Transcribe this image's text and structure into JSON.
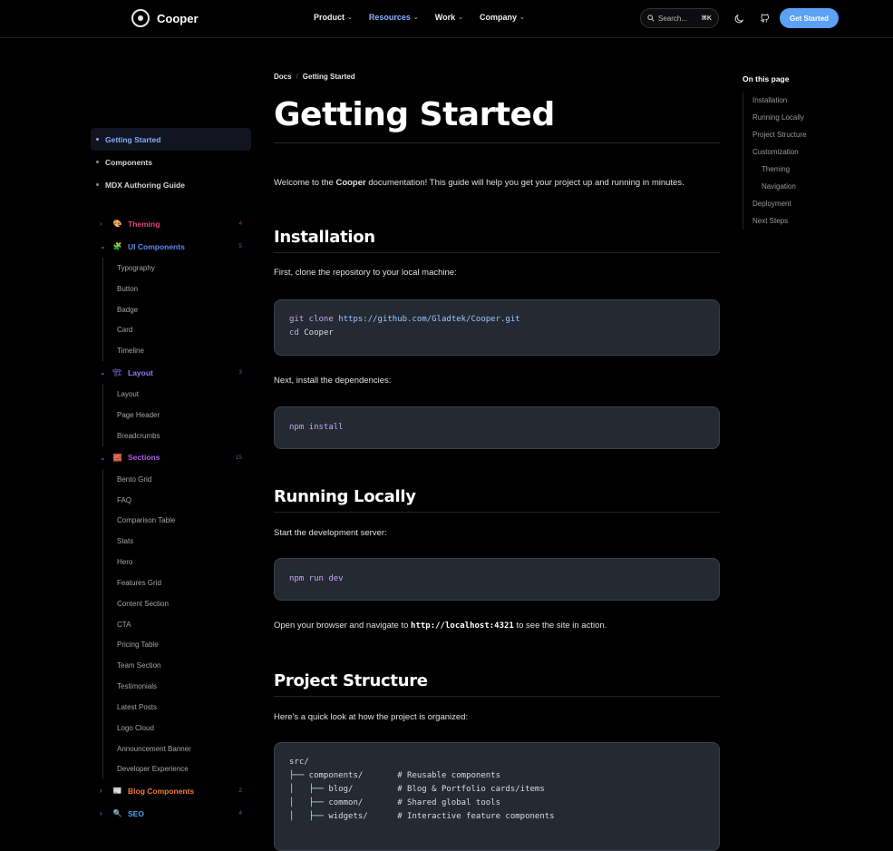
{
  "header": {
    "brand": "Cooper",
    "nav": [
      {
        "label": "Product",
        "active": false
      },
      {
        "label": "Resources",
        "active": true
      },
      {
        "label": "Work",
        "active": false
      },
      {
        "label": "Company",
        "active": false
      }
    ],
    "search_placeholder": "Search...",
    "search_shortcut": "⌘K",
    "cta_label": "Get Started"
  },
  "sidebar": {
    "top_items": [
      {
        "label": "Getting Started",
        "active": true
      },
      {
        "label": "Components",
        "active": false
      },
      {
        "label": "MDX Authoring Guide",
        "active": false
      }
    ],
    "groups": [
      {
        "label": "Theming",
        "icon": "🎨",
        "count": "4",
        "expanded": false,
        "color": "#e0457a",
        "items": []
      },
      {
        "label": "UI Components",
        "icon": "🧩",
        "count": "5",
        "expanded": true,
        "color": "#5b8cf0",
        "items": [
          "Typography",
          "Button",
          "Badge",
          "Card",
          "Timeline"
        ]
      },
      {
        "label": "Layout",
        "icon": "🏗",
        "count": "3",
        "expanded": true,
        "color": "#8d7cf5",
        "items": [
          "Layout",
          "Page Header",
          "Breadcrumbs"
        ]
      },
      {
        "label": "Sections",
        "icon": "🧱",
        "count": "15",
        "expanded": true,
        "color": "#b05be8",
        "items": [
          "Bento Grid",
          "FAQ",
          "Comparison Table",
          "Stats",
          "Hero",
          "Features Grid",
          "Content Section",
          "CTA",
          "Pricing Table",
          "Team Section",
          "Testimonials",
          "Latest Posts",
          "Logo Cloud",
          "Announcement Banner",
          "Developer Experience"
        ]
      },
      {
        "label": "Blog Components",
        "icon": "📰",
        "count": "2",
        "expanded": false,
        "color": "#f07a3a",
        "items": []
      },
      {
        "label": "SEO",
        "icon": "🔍",
        "count": "4",
        "expanded": false,
        "color": "#4aa0f0",
        "items": []
      }
    ]
  },
  "main": {
    "breadcrumb": [
      "Docs",
      "Getting Started"
    ],
    "title": "Getting Started",
    "intro_pre": "Welcome to the ",
    "intro_bold": "Cooper",
    "intro_post": " documentation! This guide will help you get your project up and running in minutes.",
    "installation": {
      "heading": "Installation",
      "clone_text": "First, clone the repository to your local machine:",
      "clone_cmd1": "git clone",
      "clone_url": "https://github.com/Gladtek/Cooper.git",
      "clone_cmd2": "cd",
      "clone_dir": "Cooper",
      "deps_text": "Next, install the dependencies:",
      "install_cmd": "npm install"
    },
    "running": {
      "heading": "Running Locally",
      "start_text": "Start the development server:",
      "dev_cmd": "npm run dev",
      "open_pre": "Open your browser and navigate to ",
      "open_url": "http://localhost:4321",
      "open_post": " to see the site in action."
    },
    "structure": {
      "heading": "Project Structure",
      "text": "Here's a quick look at how the project is organized:",
      "tree": "src/\n├── components/       # Reusable components\n│   ├── blog/         # Blog & Portfolio cards/items\n│   ├── common/       # Shared global tools\n│   ├── widgets/      # Interactive feature components"
    }
  },
  "toc": {
    "title": "On this page",
    "items": [
      {
        "label": "Installation",
        "sub": false
      },
      {
        "label": "Running Locally",
        "sub": false
      },
      {
        "label": "Project Structure",
        "sub": false
      },
      {
        "label": "Customization",
        "sub": false
      },
      {
        "label": "Theming",
        "sub": true
      },
      {
        "label": "Navigation",
        "sub": true
      },
      {
        "label": "Deployment",
        "sub": false
      },
      {
        "label": "Next Steps",
        "sub": false
      }
    ]
  }
}
